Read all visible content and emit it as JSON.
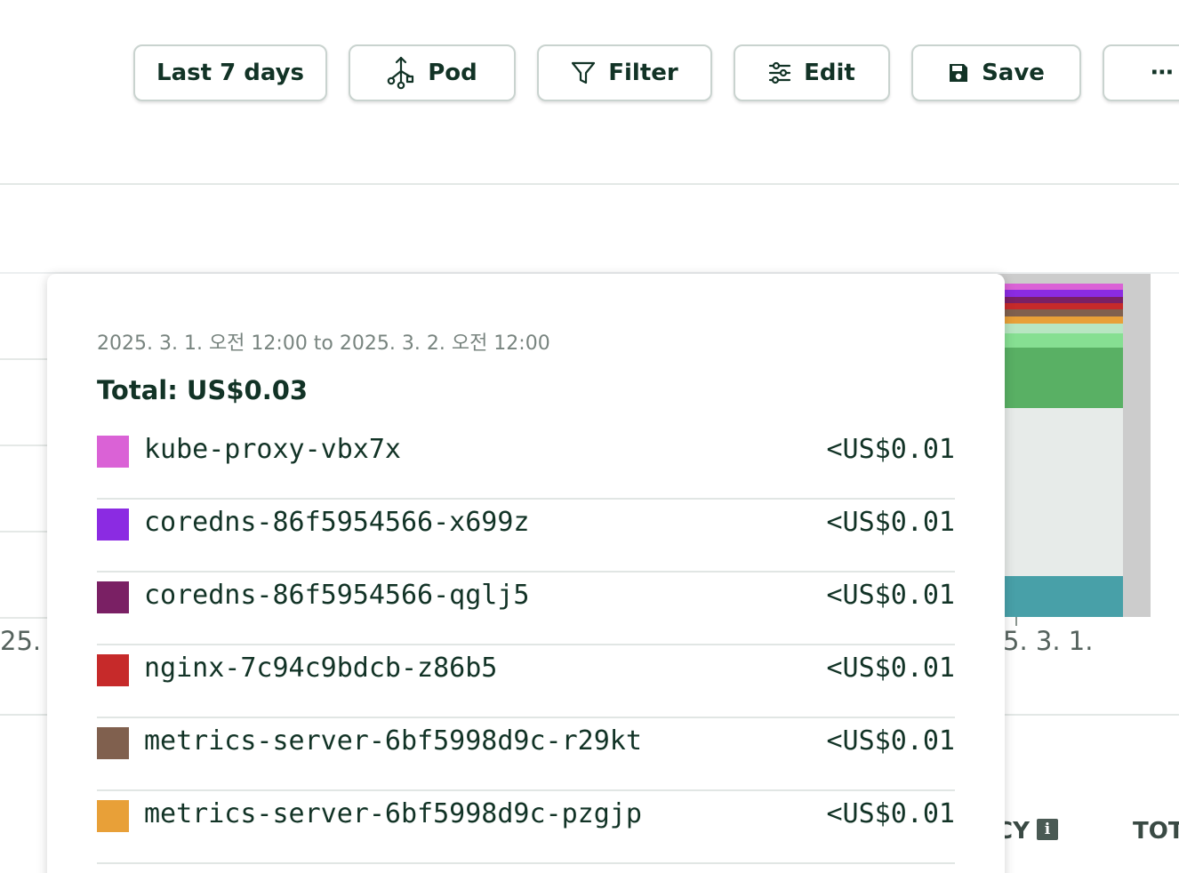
{
  "toolbar": {
    "range_label": "Last 7 days",
    "group_label": "Pod",
    "filter_label": "Filter",
    "edit_label": "Edit",
    "save_label": "Save",
    "more_label": "⋯"
  },
  "chart": {
    "left_tick_label": "25.",
    "right_tick_label": "5. 3. 1."
  },
  "table_header": {
    "col_fragment_1": "CY",
    "info_glyph": "i",
    "col_fragment_2": "TOT"
  },
  "tooltip": {
    "range": "2025. 3. 1. 오전 12:00 to 2025. 3. 2. 오전 12:00",
    "total": "Total: US$0.03",
    "rows": [
      {
        "name": "kube-proxy-vbx7x",
        "value": "<US$0.01",
        "color": "#da62d6"
      },
      {
        "name": "coredns-86f5954566-x699z",
        "value": "<US$0.01",
        "color": "#8b2be2"
      },
      {
        "name": "coredns-86f5954566-qglj5",
        "value": "<US$0.01",
        "color": "#7a2064"
      },
      {
        "name": "nginx-7c94c9bdcb-z86b5",
        "value": "<US$0.01",
        "color": "#c62a2a"
      },
      {
        "name": "metrics-server-6bf5998d9c-r29kt",
        "value": "<US$0.01",
        "color": "#80604e"
      },
      {
        "name": "metrics-server-6bf5998d9c-pzgjp",
        "value": "<US$0.01",
        "color": "#e8a038"
      }
    ]
  },
  "colors": {
    "text": "#123326",
    "border": "#c9d3cf",
    "bar_light_green": "#b8e6c2",
    "bar_green": "#86df92",
    "bar_dark_green": "#59b064",
    "bar_gray_light": "#e7ebe9",
    "bar_teal": "#48a0a8",
    "plot_background": "#cccccc"
  }
}
